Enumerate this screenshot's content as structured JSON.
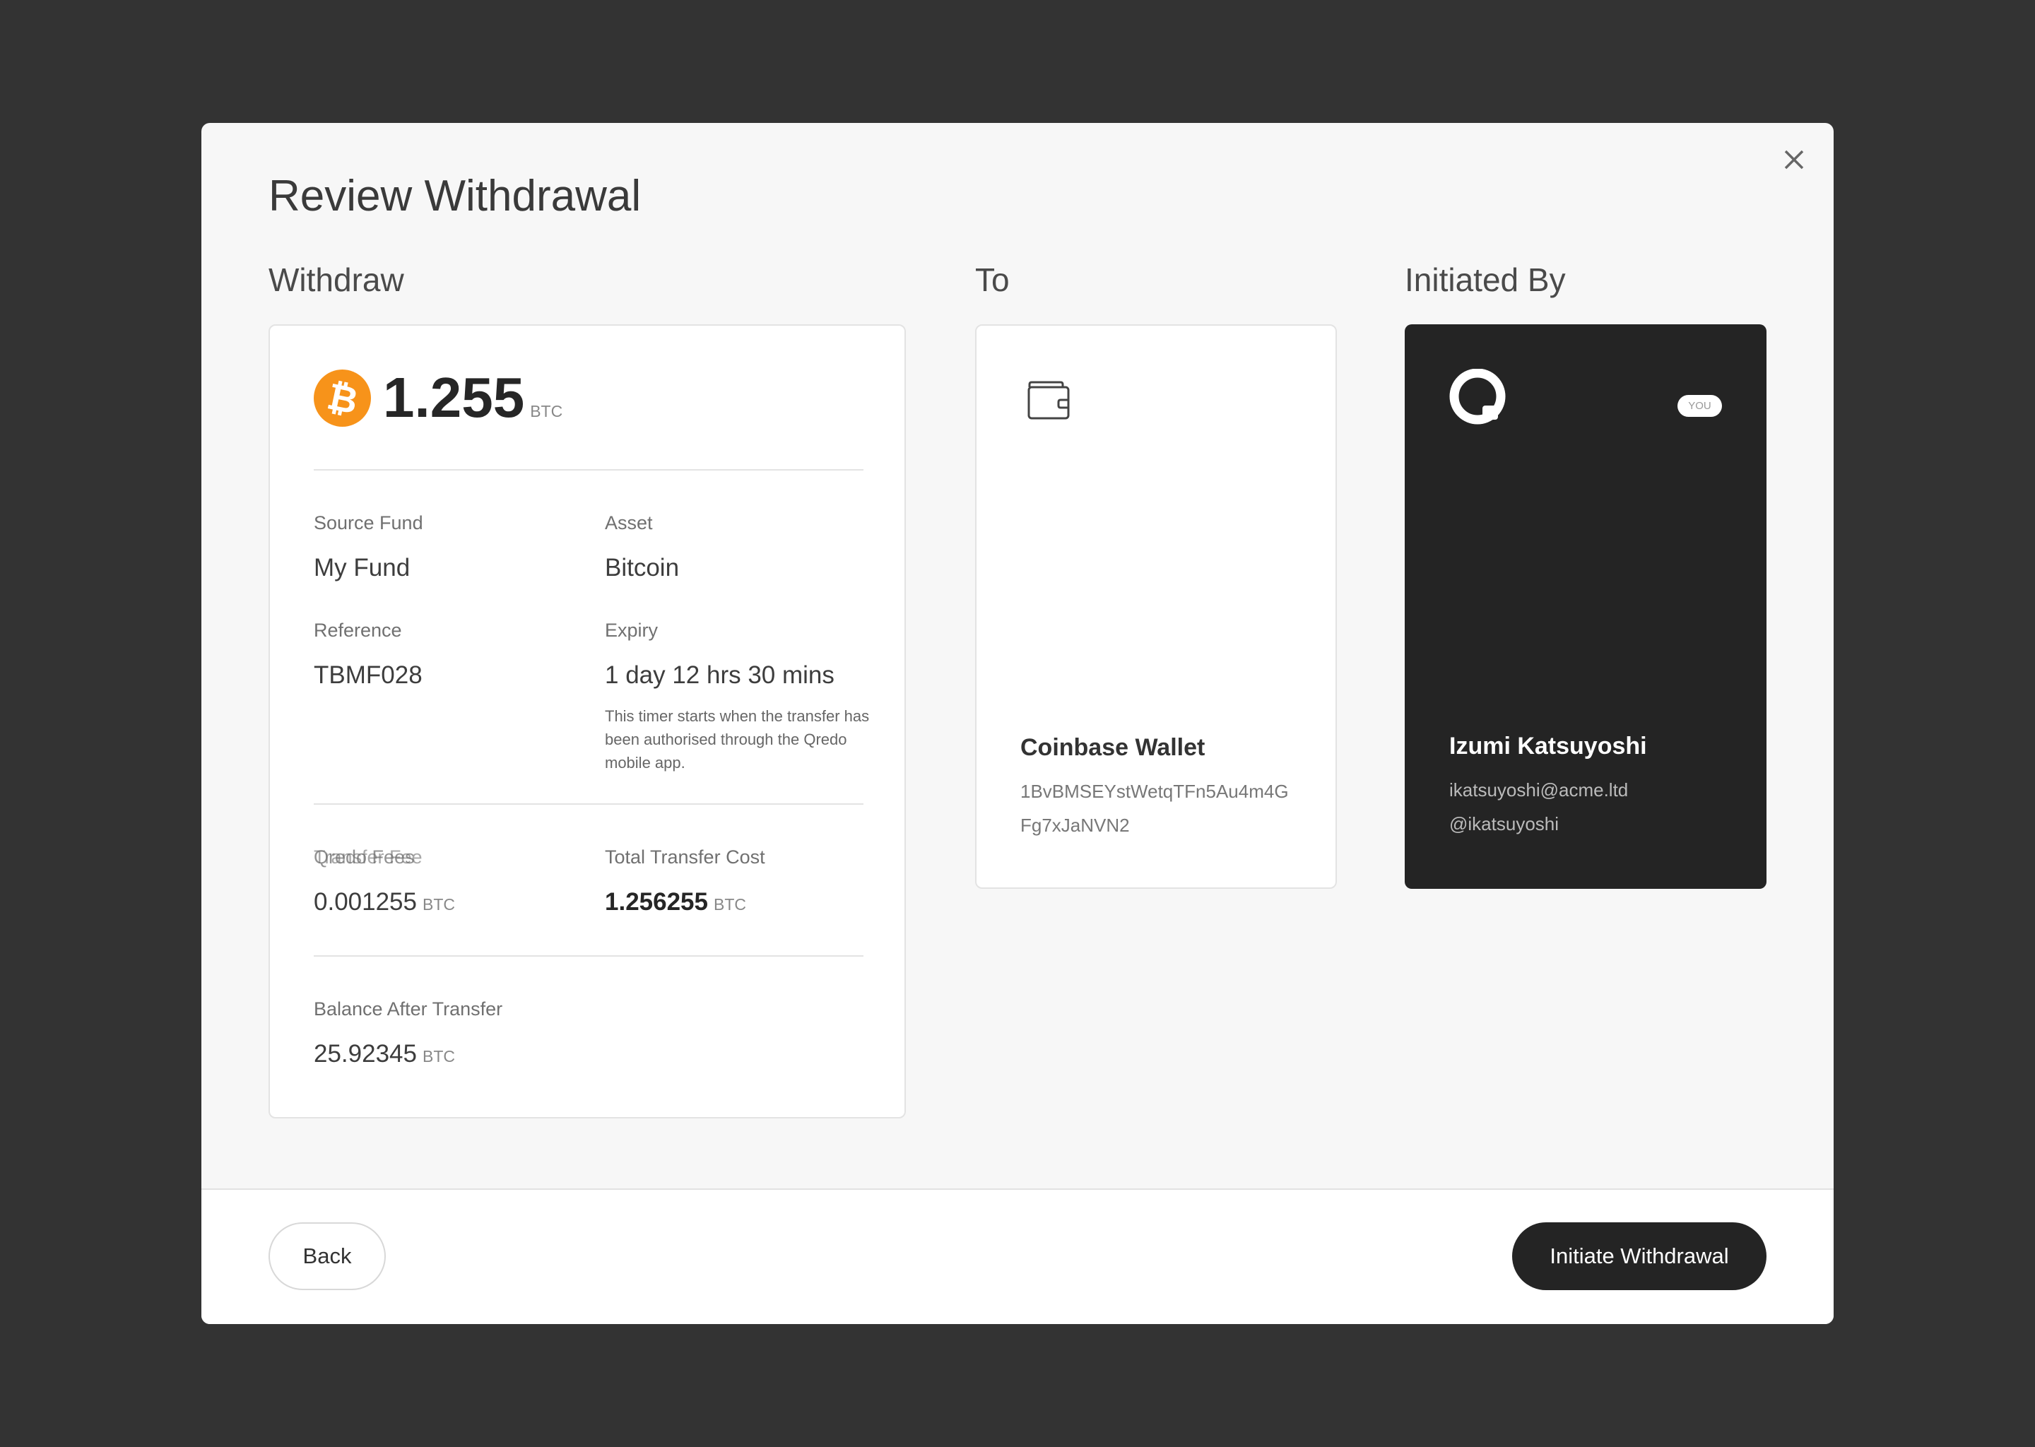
{
  "modal": {
    "title": "Review Withdrawal",
    "close_icon": "close-icon"
  },
  "withdraw": {
    "heading": "Withdraw",
    "amount": "1.255",
    "unit": "BTC",
    "asset_icon": "bitcoin-icon",
    "asset_color": "#F7931A",
    "source_fund_label": "Source Fund",
    "source_fund": "My Fund",
    "asset_label": "Asset",
    "asset": "Bitcoin",
    "reference_label": "Reference",
    "reference": "TBMF028",
    "expiry_label": "Expiry",
    "expiry": "1 day 12 hrs 30 mins",
    "expiry_note": "This timer starts when the transfer has been authorised through the Qredo mobile app.",
    "fees_label": "Qredo Fees",
    "transfer_fee_label": "Transfer Fee",
    "fee": "0.001255",
    "total_label": "Total Transfer Cost",
    "total": "1.256255",
    "balance_label": "Balance After Transfer",
    "balance": "25.92345"
  },
  "to": {
    "heading": "To",
    "icon": "wallet-icon",
    "name": "Coinbase Wallet",
    "address_line1": "1BvBMSEYstWetqTFn5Au4m4G",
    "address_line2": "Fg7xJaNVN2"
  },
  "initiated_by": {
    "heading": "Initiated By",
    "logo": "qredo-logo",
    "badge": "YOU",
    "name": "Izumi Katsuyoshi",
    "email": "ikatsuyoshi@acme.ltd",
    "handle": "@ikatsuyoshi"
  },
  "footer": {
    "back": "Back",
    "initiate": "Initiate Withdrawal"
  }
}
